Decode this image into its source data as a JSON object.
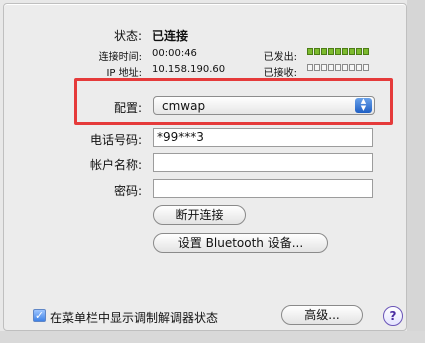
{
  "status": {
    "status_label": "状态:",
    "status_value": "已连接",
    "connect_time_label": "连接时间:",
    "connect_time_value": "00:00:46",
    "ip_label": "IP 地址:",
    "ip_value": "10.158.190.60",
    "sent_label": "已发出:",
    "received_label": "已接收:",
    "sent_level": 1,
    "received_level": 0,
    "colors": {
      "meter_on": "#7dbb2f"
    }
  },
  "config": {
    "label": "配置:",
    "selected": "cmwap"
  },
  "fields": {
    "phone_label": "电话号码:",
    "phone_value": "*99***3",
    "account_label": "帐户名称:",
    "account_value": "",
    "password_label": "密码:",
    "password_value": ""
  },
  "buttons": {
    "disconnect": "断开连接",
    "bluetooth_setup": "设置 Bluetooth 设备...",
    "advanced": "高级...",
    "help": "?"
  },
  "options": {
    "show_modem_status_label": "在菜单栏中显示调制解调器状态",
    "show_modem_status_checked": true
  },
  "highlight": {
    "color": "#e53a3a"
  },
  "icons": [
    "dropdown-arrows-icon",
    "checkbox-check-icon",
    "help-icon"
  ]
}
